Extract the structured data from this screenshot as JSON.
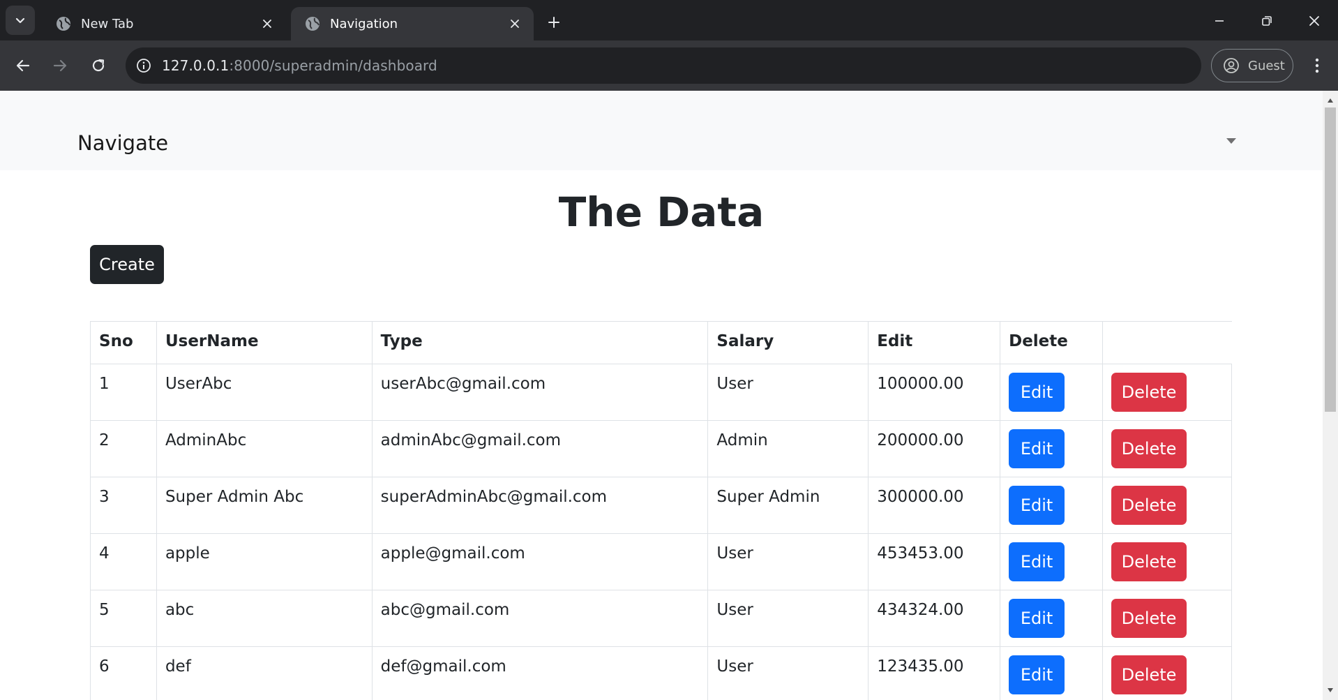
{
  "browser": {
    "tabs": [
      {
        "title": "New Tab",
        "active": false
      },
      {
        "title": "Navigation",
        "active": true
      }
    ],
    "url_host": "127.0.0.1",
    "url_rest": ":8000/superadmin/dashboard",
    "profile_label": "Guest"
  },
  "navbar": {
    "brand": "Navigate"
  },
  "page": {
    "heading": "The Data",
    "create_label": "Create"
  },
  "table": {
    "headers": [
      "Sno",
      "UserName",
      "Type",
      "Salary",
      "Edit",
      "Delete",
      ""
    ],
    "rows": [
      {
        "sno": "1",
        "username": "UserAbc",
        "email": "userAbc@gmail.com",
        "type": "User",
        "salary": "100000.00"
      },
      {
        "sno": "2",
        "username": "AdminAbc",
        "email": "adminAbc@gmail.com",
        "type": "Admin",
        "salary": "200000.00"
      },
      {
        "sno": "3",
        "username": "Super Admin Abc",
        "email": "superAdminAbc@gmail.com",
        "type": "Super Admin",
        "salary": "300000.00"
      },
      {
        "sno": "4",
        "username": "apple",
        "email": "apple@gmail.com",
        "type": "User",
        "salary": "453453.00"
      },
      {
        "sno": "5",
        "username": "abc",
        "email": "abc@gmail.com",
        "type": "User",
        "salary": "434324.00"
      },
      {
        "sno": "6",
        "username": "def",
        "email": "def@gmail.com",
        "type": "User",
        "salary": "123435.00"
      }
    ],
    "edit_label": "Edit",
    "delete_label": "Delete"
  },
  "colors": {
    "edit_button": "#0d6efd",
    "delete_button": "#dc3545",
    "create_button": "#212529",
    "navbar_bg": "#f8f9fa"
  },
  "icons": {
    "tab_search": "chevron-down-icon",
    "tab_favicon": "globe-icon",
    "tab_close": "close-icon",
    "new_tab": "plus-icon",
    "back": "arrow-left-icon",
    "forward": "arrow-right-icon",
    "reload": "reload-icon",
    "site_info": "info-icon",
    "profile": "account-circle-icon",
    "menu": "kebab-menu-icon",
    "navbar_toggle": "caret-down-icon"
  }
}
